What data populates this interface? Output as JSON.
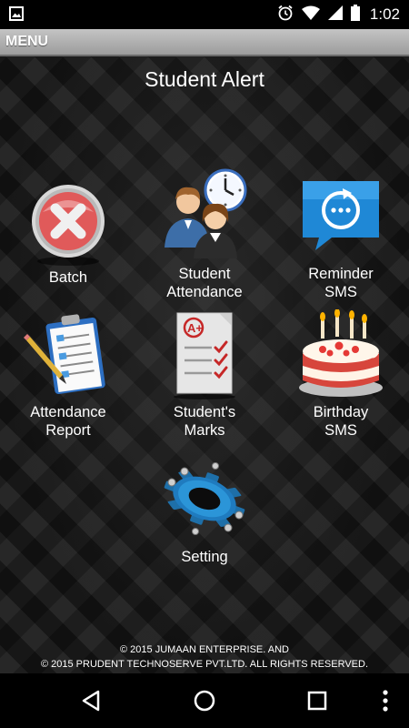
{
  "status_bar": {
    "time": "1:02",
    "icons": [
      "image-icon",
      "alarm-icon",
      "wifi-icon",
      "signal-icon",
      "battery-icon"
    ]
  },
  "menu_bar": {
    "label": "MENU"
  },
  "app": {
    "title": "Student Alert"
  },
  "tiles": [
    {
      "label_line1": "Batch",
      "label_line2": "",
      "icon": "cancel-x-icon"
    },
    {
      "label_line1": "Student",
      "label_line2": "Attendance",
      "icon": "people-clock-icon"
    },
    {
      "label_line1": "Reminder",
      "label_line2": "SMS",
      "icon": "message-refresh-icon"
    },
    {
      "label_line1": "Attendance",
      "label_line2": "Report",
      "icon": "clipboard-report-icon"
    },
    {
      "label_line1": "Student's",
      "label_line2": "Marks",
      "icon": "marks-sheet-icon"
    },
    {
      "label_line1": "Birthday",
      "label_line2": "SMS",
      "icon": "birthday-cake-icon"
    },
    {
      "label_line1": "Setting",
      "label_line2": "",
      "icon": "gear-icon"
    }
  ],
  "footer": {
    "line1": "© 2015 JUMAAN ENTERPRISE. AND",
    "line2": "© 2015 PRUDENT TECHNOSERVE PVT.LTD. ALL RIGHTS RESERVED."
  },
  "nav_bar": {
    "icons": [
      "back-icon",
      "home-icon",
      "recents-icon",
      "overflow-menu-icon"
    ]
  },
  "colors": {
    "menu_bar": "#b0b0b0",
    "background": "#1a1a1a",
    "accent_blue": "#1e88d8"
  }
}
